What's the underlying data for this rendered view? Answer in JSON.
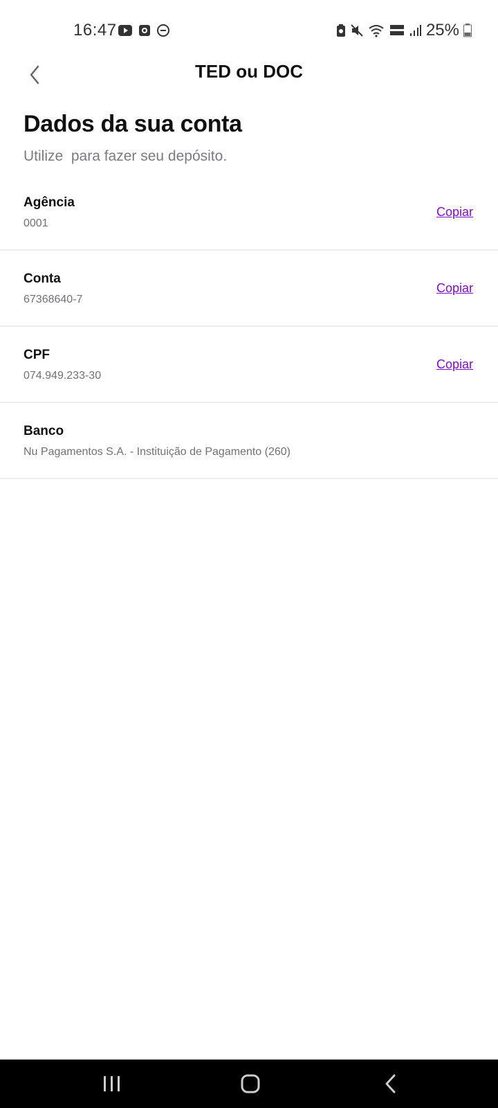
{
  "status_bar": {
    "time": "16:47",
    "battery": "25%",
    "left_icons": [
      "youtube-icon",
      "screen-record-icon",
      "do-not-disturb-icon"
    ],
    "right_icons": [
      "battery-saver-icon",
      "mute-icon",
      "wifi-icon",
      "volte-icon",
      "signal-icon",
      "battery-icon"
    ]
  },
  "header": {
    "title": "TED ou DOC"
  },
  "content": {
    "title": "Dados da sua conta",
    "subtitle": "Utilize  para fazer seu depósito.",
    "rows": [
      {
        "label": "Agência",
        "value": "0001",
        "action": "Copiar"
      },
      {
        "label": "Conta",
        "value": "67368640-7",
        "action": "Copiar"
      },
      {
        "label": "CPF",
        "value": "074.949.233-30",
        "action": "Copiar"
      },
      {
        "label": "Banco",
        "value": "Nu Pagamentos S.A. - Instituição de Pagamento (260)"
      }
    ]
  },
  "colors": {
    "accent": "#820ad1",
    "text_primary": "#111111",
    "text_secondary": "#707076",
    "divider": "#eeeeee",
    "nav_bar": "#000000"
  }
}
